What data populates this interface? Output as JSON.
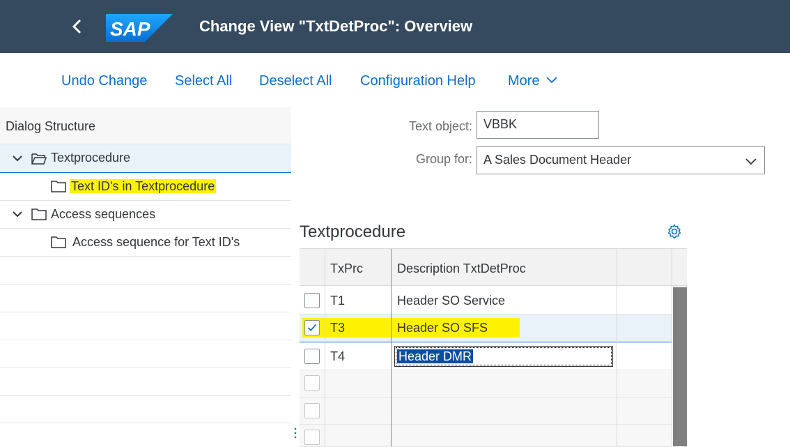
{
  "header": {
    "title": "Change View \"TxtDetProc\": Overview",
    "logo_text": "SAP"
  },
  "toolbar": {
    "undo": "Undo Change",
    "select_all": "Select All",
    "deselect_all": "Deselect All",
    "config_help": "Configuration Help",
    "more": "More"
  },
  "dialog": {
    "heading": "Dialog Structure",
    "items": [
      {
        "label": "Textprocedure",
        "level": 0,
        "expanded": true,
        "selected": true
      },
      {
        "label": "Text ID's in Textprocedure",
        "level": 1,
        "highlighted": true
      },
      {
        "label": "Access sequences",
        "level": 0,
        "expanded": true
      },
      {
        "label": "Access sequence for Text ID's",
        "level": 1
      }
    ]
  },
  "form": {
    "text_object_label": "Text object:",
    "text_object_value": "VBBK",
    "group_for_label": "Group for:",
    "group_for_value": "A Sales Document Header"
  },
  "table": {
    "title": "Textprocedure",
    "columns": [
      "TxPrc",
      "Description TxtDetProc"
    ],
    "rows": [
      {
        "code": "T1",
        "desc": "Header SO Service",
        "checked": false
      },
      {
        "code": "T3",
        "desc": "Header SO SFS",
        "checked": true,
        "highlighted": true
      },
      {
        "code": "T4",
        "desc": "Header DMR",
        "checked": false,
        "editing": true
      }
    ]
  },
  "colors": {
    "shell": "#354a5f",
    "link": "#0a6ed1",
    "highlight": "#fff200",
    "selection": "#e9f1f9"
  },
  "icons": [
    "back-arrow-icon",
    "sap-logo",
    "chevron-down-icon",
    "folder-open-icon",
    "folder-icon",
    "gear-icon",
    "dropdown-arrow-icon",
    "checkmark-icon"
  ]
}
